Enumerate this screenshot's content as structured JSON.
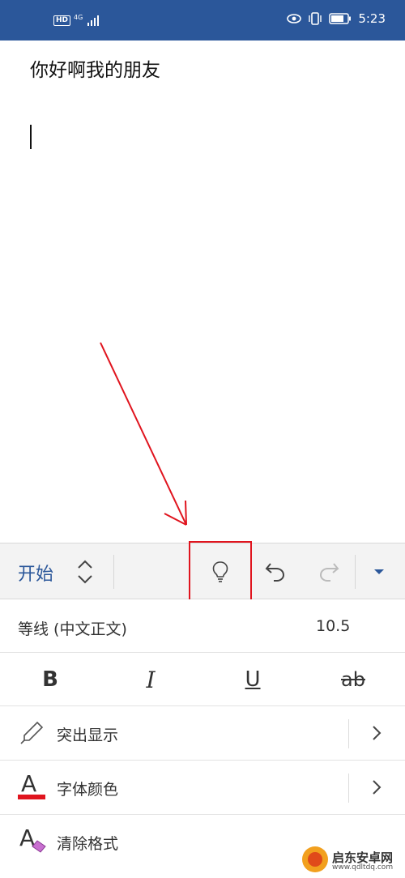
{
  "status_bar": {
    "hd_label": "HD",
    "network_label": "4G",
    "time": "5:23",
    "icons": [
      "signal-icon",
      "eye-icon",
      "vibrate-icon",
      "battery-icon"
    ]
  },
  "document": {
    "text": "你好啊我的朋友"
  },
  "toolbar": {
    "tab_label": "开始",
    "buttons": [
      "tell-me-lightbulb-icon",
      "undo-icon",
      "redo-icon",
      "collapse-ribbon-icon"
    ],
    "highlight_color": "#e0141e"
  },
  "font_row": {
    "font_name": "等线 (中文正文)",
    "font_size": "10.5"
  },
  "format_row": {
    "bold": "B",
    "italic": "I",
    "underline": "U",
    "strikethrough": "ab"
  },
  "menu": {
    "highlight_label": "突出显示",
    "font_color_label": "字体颜色",
    "font_color_glyph": "A",
    "font_color_value": "#e0141e",
    "clear_format_label": "清除格式",
    "clear_format_glyph": "A"
  },
  "watermark": {
    "line1": "启东安卓网",
    "line2": "www.qdltdq.com"
  },
  "colors": {
    "accent": "#2b579a",
    "annotation_red": "#e0141e"
  }
}
